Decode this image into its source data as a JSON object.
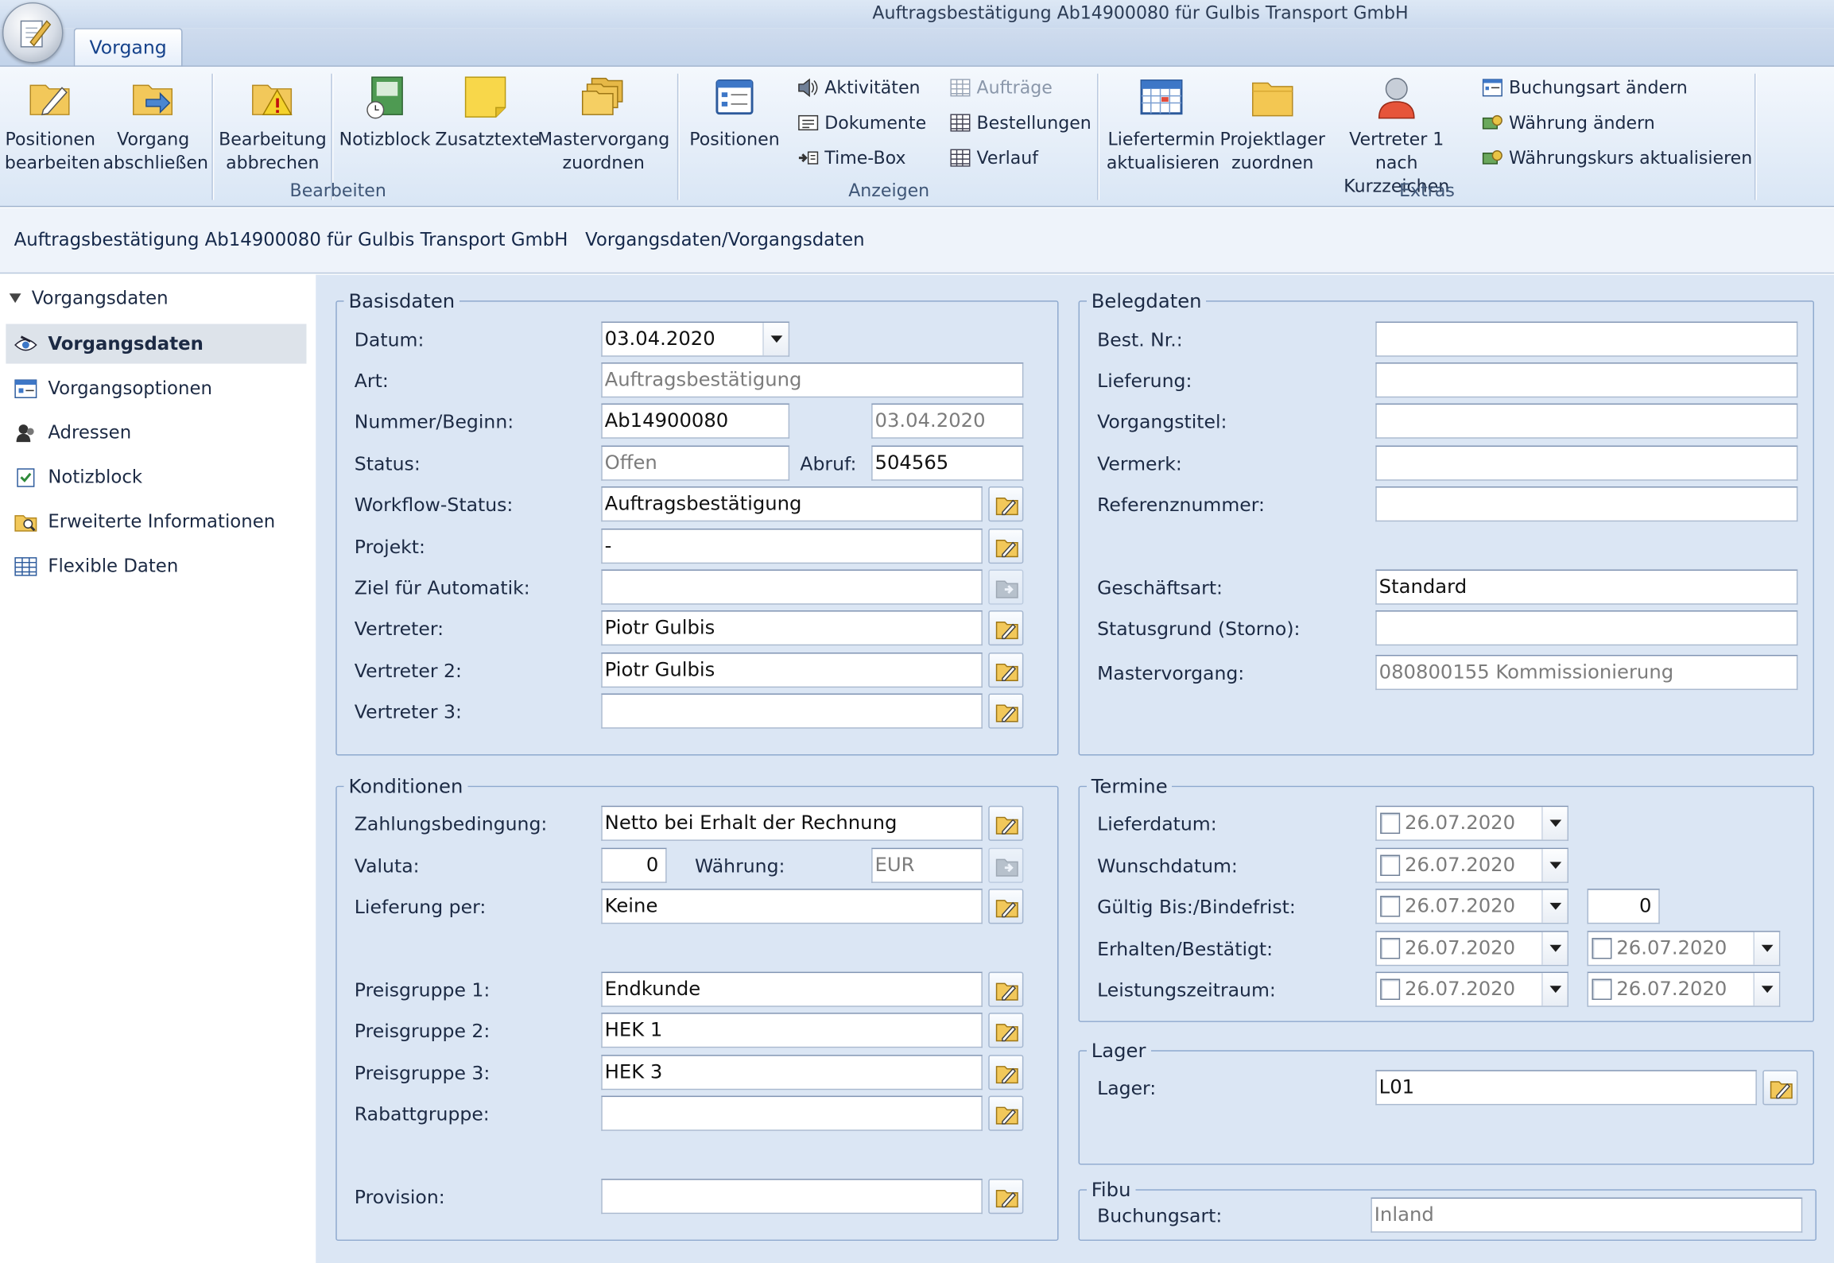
{
  "window": {
    "title": "Auftragsbestätigung Ab14900080 für Gulbis Transport GmbH"
  },
  "tabs": [
    {
      "label": "Vorgang"
    }
  ],
  "ribbon": {
    "bearbeiten": {
      "group_label": "Bearbeiten",
      "positionen_bearbeiten": [
        "Positionen",
        "bearbeiten"
      ],
      "vorgang_abschliessen": [
        "Vorgang",
        "abschließen"
      ],
      "bearbeitung_abbrechen": [
        "Bearbeitung",
        "abbrechen"
      ],
      "notizblock": "Notizblock",
      "zusatztexte": "Zusatztexte",
      "mastervorgang_zuordnen": [
        "Mastervorgang",
        "zuordnen"
      ]
    },
    "anzeigen": {
      "group_label": "Anzeigen",
      "positionen": "Positionen",
      "aktivitaeten": "Aktivitäten",
      "dokumente": "Dokumente",
      "timebox": "Time-Box",
      "auftraege": "Aufträge",
      "bestellungen": "Bestellungen",
      "verlauf": "Verlauf"
    },
    "extras": {
      "group_label": "Extras",
      "liefertermin_aktualisieren": [
        "Liefertermin",
        "aktualisieren"
      ],
      "projektlager_zuordnen": [
        "Projektlager",
        "zuordnen"
      ],
      "vertreter1_kurzzeichen": [
        "Vertreter 1 nach",
        "Kurzzeichen"
      ],
      "buchungsart_aendern": "Buchungsart ändern",
      "waehrung_aendern": "Währung ändern",
      "waehrungskurs_aktualisieren": "Währungskurs aktualisieren"
    }
  },
  "breadcrumb": "Auftragsbestätigung Ab14900080 für Gulbis Transport GmbH   Vorgangsdaten/Vorgangsdaten",
  "sidebar": {
    "header": "Vorgangsdaten",
    "items": [
      {
        "label": "Vorgangsdaten",
        "selected": true
      },
      {
        "label": "Vorgangsoptionen"
      },
      {
        "label": "Adressen"
      },
      {
        "label": "Notizblock"
      },
      {
        "label": "Erweiterte Informationen"
      },
      {
        "label": "Flexible Daten"
      }
    ]
  },
  "basisdaten": {
    "legend": "Basisdaten",
    "datum": {
      "label": "Datum:",
      "value": "03.04.2020"
    },
    "art": {
      "label": "Art:",
      "value": "Auftragsbestätigung"
    },
    "nummer": {
      "label": "Nummer/Beginn:",
      "value": "Ab14900080",
      "beginn": "03.04.2020"
    },
    "status": {
      "label": "Status:",
      "value": "Offen",
      "abruf_label": "Abruf:",
      "abruf": "504565"
    },
    "workflow_status": {
      "label": "Workflow-Status:",
      "value": "Auftragsbestätigung"
    },
    "projekt": {
      "label": "Projekt:",
      "value": "-"
    },
    "ziel_automatik": {
      "label": "Ziel für Automatik:",
      "value": ""
    },
    "vertreter": {
      "label": "Vertreter:",
      "value": "Piotr Gulbis"
    },
    "vertreter2": {
      "label": "Vertreter 2:",
      "value": "Piotr Gulbis"
    },
    "vertreter3": {
      "label": "Vertreter 3:",
      "value": ""
    }
  },
  "belegdaten": {
    "legend": "Belegdaten",
    "best_nr": {
      "label": "Best. Nr.:",
      "value": ""
    },
    "lieferung": {
      "label": "Lieferung:",
      "value": ""
    },
    "vorgangstitel": {
      "label": "Vorgangstitel:",
      "value": ""
    },
    "vermerk": {
      "label": "Vermerk:",
      "value": ""
    },
    "referenznummer": {
      "label": "Referenznummer:",
      "value": ""
    },
    "geschaeftsart": {
      "label": "Geschäftsart:",
      "value": "Standard"
    },
    "statusgrund": {
      "label": "Statusgrund (Storno):",
      "value": ""
    },
    "mastervorgang": {
      "label": "Mastervorgang:",
      "value": "080800155 Kommissionierung"
    }
  },
  "konditionen": {
    "legend": "Konditionen",
    "zahlungsbedingung": {
      "label": "Zahlungsbedingung:",
      "value": "Netto bei Erhalt der Rechnung"
    },
    "valuta": {
      "label": "Valuta:",
      "value": "0",
      "waehrung_label": "Währung:",
      "waehrung": "EUR"
    },
    "lieferung_per": {
      "label": "Lieferung per:",
      "value": "Keine"
    },
    "preisgruppe1": {
      "label": "Preisgruppe 1:",
      "value": "Endkunde"
    },
    "preisgruppe2": {
      "label": "Preisgruppe 2:",
      "value": "HEK 1"
    },
    "preisgruppe3": {
      "label": "Preisgruppe 3:",
      "value": "HEK 3"
    },
    "rabattgruppe": {
      "label": "Rabattgruppe:",
      "value": ""
    },
    "provision": {
      "label": "Provision:",
      "value": ""
    }
  },
  "termine": {
    "legend": "Termine",
    "lieferdatum": {
      "label": "Lieferdatum:",
      "value": "26.07.2020"
    },
    "wunschdatum": {
      "label": "Wunschdatum:",
      "value": "26.07.2020"
    },
    "gueltig_bis": {
      "label": "Gültig Bis:/Bindefrist:",
      "value": "26.07.2020",
      "bindefrist": "0"
    },
    "erhalten": {
      "label": "Erhalten/Bestätigt:",
      "value": "26.07.2020",
      "bestaetigt": "26.07.2020"
    },
    "leistungszeitraum": {
      "label": "Leistungszeitraum:",
      "von": "26.07.2020",
      "bis": "26.07.2020"
    }
  },
  "lager": {
    "legend": "Lager",
    "lager": {
      "label": "Lager:",
      "value": "L01"
    }
  },
  "fibu": {
    "legend": "Fibu",
    "buchungsart": {
      "label": "Buchungsart:",
      "value": "Inland"
    }
  }
}
